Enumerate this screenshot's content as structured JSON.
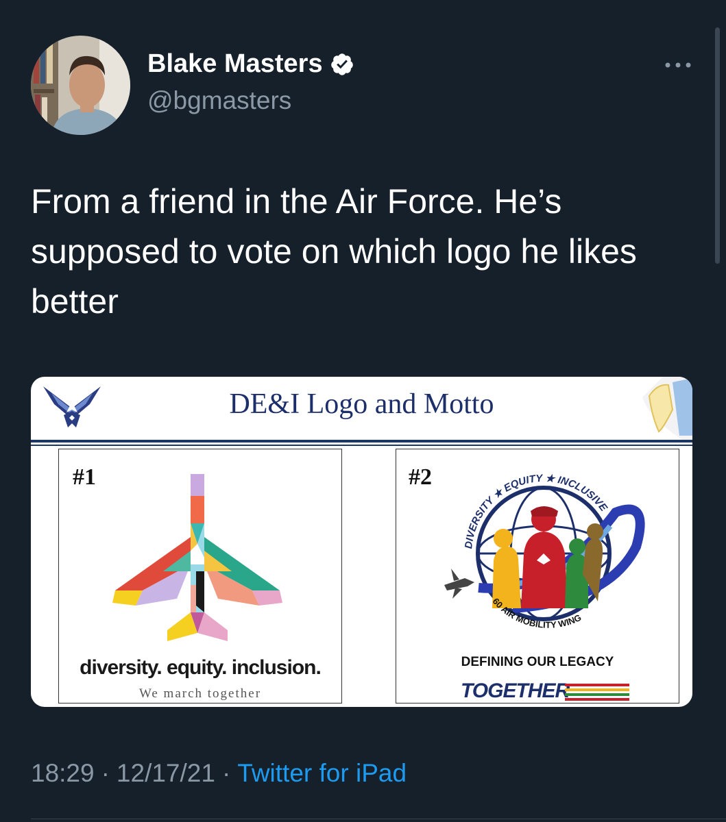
{
  "author": {
    "display_name": "Blake Masters",
    "handle": "@bgmasters",
    "verified": true,
    "avatar": "profile-photo"
  },
  "tweet": {
    "text": "From a friend in the Air Force. He’s supposed to vote on which logo he likes better"
  },
  "media": {
    "slide_title": "DE&I Logo and Motto",
    "option1": {
      "number": "#1",
      "slogan": "diversity. equity. inclusion.",
      "motto": "We march together"
    },
    "option2": {
      "number": "#2",
      "badge_top": "DIVERSITY ★ EQUITY ★ INCLUSIVE",
      "badge_bottom": "60 AIR MOBILITY WING",
      "slogan": "DEFINING OUR LEGACY",
      "together": "TOGETHER"
    }
  },
  "footer": {
    "time": "18:29",
    "date": "12/17/21",
    "separator": "·",
    "source": "Twitter for iPad"
  },
  "colors": {
    "background": "#15202b",
    "secondary_text": "#8b98a5",
    "link": "#1d9bf0"
  },
  "icons": [
    "more-icon",
    "verified-badge-icon"
  ]
}
